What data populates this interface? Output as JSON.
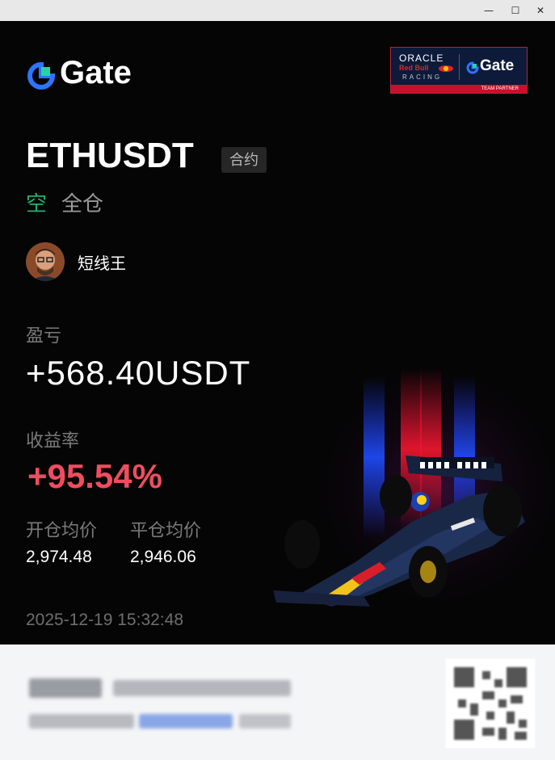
{
  "window": {
    "minimize_icon": "—",
    "maximize_icon": "☐",
    "close_icon": "✕"
  },
  "brand": {
    "logo_text": "Gate"
  },
  "partner_badge": {
    "oracle": "ORACLE",
    "redbull": "Red Bull",
    "racing": "RACING",
    "gate": "Gate",
    "team_partner": "TEAM PARTNER"
  },
  "position": {
    "symbol": "ETHUSDT",
    "type_tag": "合约",
    "side": "空",
    "margin_mode": "全仓"
  },
  "user": {
    "name": "短线王"
  },
  "pnl": {
    "label": "盈亏",
    "value": "+568.40USDT"
  },
  "roi": {
    "label": "收益率",
    "value": "+95.54%"
  },
  "prices": {
    "open_label": "开仓均价",
    "open_value": "2,974.48",
    "close_label": "平仓均价",
    "close_value": "2,946.06"
  },
  "timestamp": "2025-12-19 15:32:48",
  "colors": {
    "background": "#050505",
    "short_green": "#20b26c",
    "profit_red": "#ef4d5f",
    "label_grey": "#7a7a7a",
    "footer_bg": "#f4f5f7"
  }
}
